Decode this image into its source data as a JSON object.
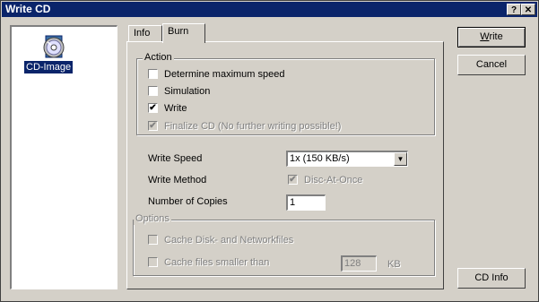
{
  "window": {
    "title": "Write CD",
    "help_glyph": "?",
    "close_glyph": "✕"
  },
  "file_list": {
    "items": [
      {
        "label": "CD-Image",
        "icon": "cd-image-icon",
        "selected": true
      }
    ]
  },
  "tabs": [
    {
      "label": "Info",
      "active": false
    },
    {
      "label": "Burn",
      "active": true
    }
  ],
  "action_group": {
    "title": "Action",
    "options": [
      {
        "label": "Determine maximum speed",
        "checked": false,
        "enabled": true
      },
      {
        "label": "Simulation",
        "checked": false,
        "enabled": true
      },
      {
        "label": "Write",
        "checked": true,
        "enabled": true
      },
      {
        "label": "Finalize CD (No further writing possible!)",
        "checked": true,
        "enabled": false
      }
    ]
  },
  "settings": {
    "write_speed": {
      "label": "Write Speed",
      "value": "1x (150 KB/s)",
      "arrow": "▼"
    },
    "write_method": {
      "label": "Write Method",
      "option_label": "Disc-At-Once",
      "checked": true,
      "enabled": false
    },
    "copies": {
      "label": "Number of Copies",
      "value": "1"
    }
  },
  "options_group": {
    "title": "Options",
    "cache_disk": {
      "label": "Cache Disk- and Networkfiles",
      "checked": false,
      "enabled": false
    },
    "cache_small": {
      "label": "Cache files smaller than",
      "checked": false,
      "enabled": false,
      "value": "128",
      "unit": "KB"
    }
  },
  "buttons": {
    "write": {
      "prefix": "",
      "mnemonic": "W",
      "rest": "rite"
    },
    "cancel": "Cancel",
    "cd_info": "CD Info"
  },
  "check_glyph": "✔"
}
